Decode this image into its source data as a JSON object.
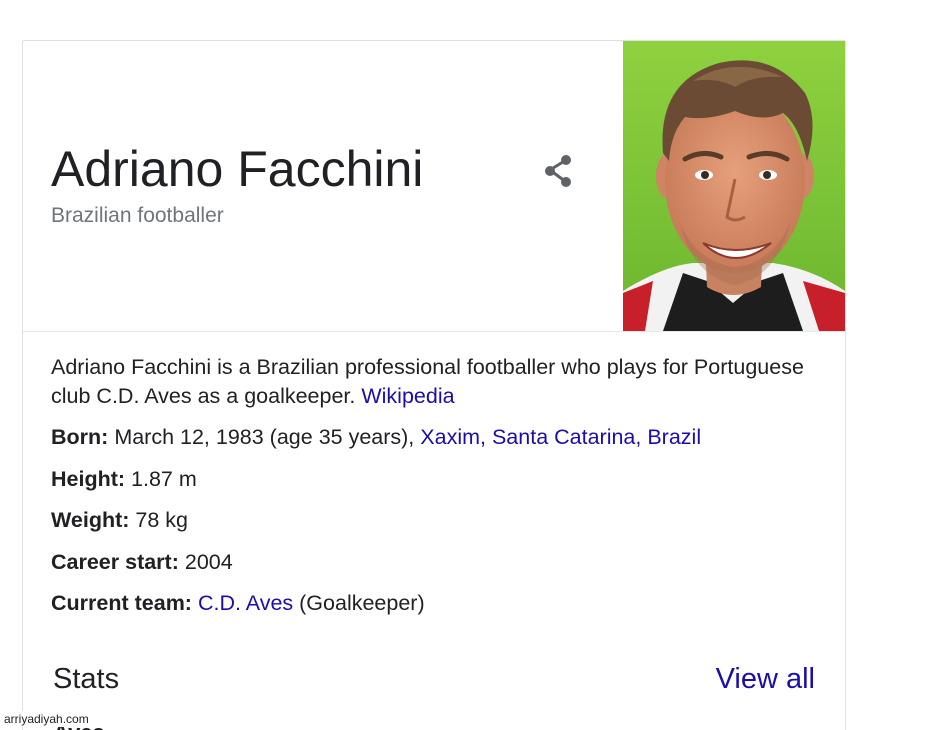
{
  "panel": {
    "title": "Adriano Facchini",
    "subtitle": "Brazilian footballer",
    "share_icon": "share-icon",
    "photo_alt": "Adriano Facchini photo"
  },
  "description": {
    "text": "Adriano Facchini is a Brazilian professional footballer who plays for Portuguese club C.D. Aves as a goalkeeper.",
    "source_link": "Wikipedia"
  },
  "facts": {
    "born": {
      "label": "Born:",
      "value": "March 12, 1983 (age 35 years),",
      "place_link": "Xaxim, Santa Catarina, Brazil"
    },
    "height": {
      "label": "Height:",
      "value": "1.87 m"
    },
    "weight": {
      "label": "Weight:",
      "value": "78 kg"
    },
    "career_start": {
      "label": "Career start:",
      "value": "2004"
    },
    "current_team": {
      "label": "Current team:",
      "link": "C.D. Aves",
      "suffix": "(Goalkeeper)"
    }
  },
  "stats": {
    "title": "Stats",
    "view_all": "View all",
    "partial_row": "Aves"
  },
  "watermark": "arriyadiyah.com",
  "colors": {
    "link": "#1a0dab",
    "text": "#202124",
    "secondary": "#70757a",
    "photo_background": "#7cc63a"
  }
}
